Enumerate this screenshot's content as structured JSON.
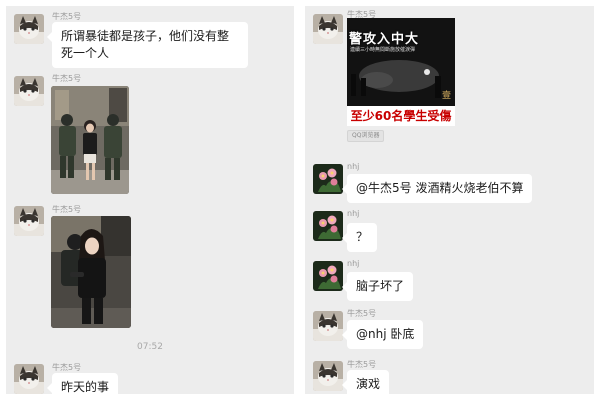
{
  "left_panel": {
    "messages": [
      {
        "sender": "牛杰5号",
        "text": "所谓暴徒都是孩子，他们没有整死一个人"
      },
      {
        "sender": "牛杰5号"
      },
      {
        "sender": "牛杰5号"
      },
      {
        "sender": "牛杰5号",
        "text": "昨天的事"
      }
    ],
    "timestamp": "07:52"
  },
  "right_panel": {
    "news_card": {
      "sender": "牛杰5号",
      "title": "警攻入中大",
      "subtitle": "連續三小時無間斷施放催淚彈",
      "mark": "壹",
      "headline": "至少60名學生受傷",
      "source": "QQ浏览器"
    },
    "messages": [
      {
        "sender": "nhj",
        "text": "@牛杰5号 泼酒精火烧老伯不算"
      },
      {
        "sender": "nhj",
        "text": "？"
      },
      {
        "sender": "nhj",
        "text": "脑子坏了"
      },
      {
        "sender": "牛杰5号",
        "text": "@nhj 卧底"
      },
      {
        "sender": "牛杰5号",
        "text": "演戏"
      }
    ]
  },
  "icons": {
    "cat_avatar": "cat-avatar-icon",
    "flower_avatar": "flower-avatar-icon"
  },
  "colors": {
    "chat_background": "#ededed",
    "bubble": "#ffffff",
    "headline_red": "#c80000"
  }
}
